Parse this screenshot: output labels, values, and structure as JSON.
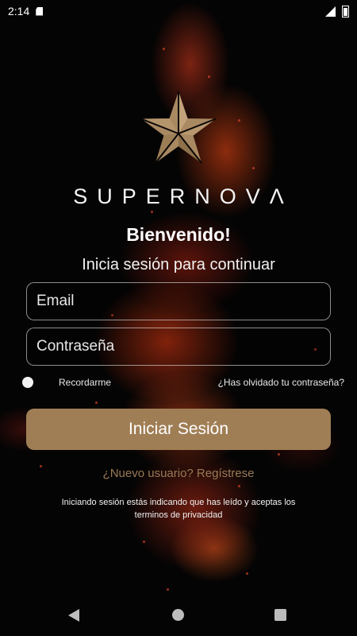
{
  "status_bar": {
    "time": "2:14",
    "icons": [
      "sd-card-icon",
      "signal-icon",
      "battery-icon"
    ]
  },
  "brand": {
    "logo_icon": "star-icon",
    "name": "SUPERNOVΛ",
    "logo_color": "#a07e55"
  },
  "login": {
    "welcome": "Bienvenido!",
    "subtitle": "Inicia sesión para continuar",
    "email_placeholder": "Email",
    "password_placeholder": "Contraseña",
    "remember_label": "Recordarme",
    "forgot_label": "¿Has olvidado tu contraseña?",
    "submit_label": "Iniciar Sesión",
    "register_label": "¿Nuevo usuario? Regístrese",
    "terms_text": "Iniciando sesión estás indicando que has leído y aceptas los terminos de privacidad",
    "accent_color": "#a07e55"
  },
  "nav_bar": {
    "icons": [
      "back-icon",
      "home-icon",
      "recent-apps-icon"
    ]
  }
}
